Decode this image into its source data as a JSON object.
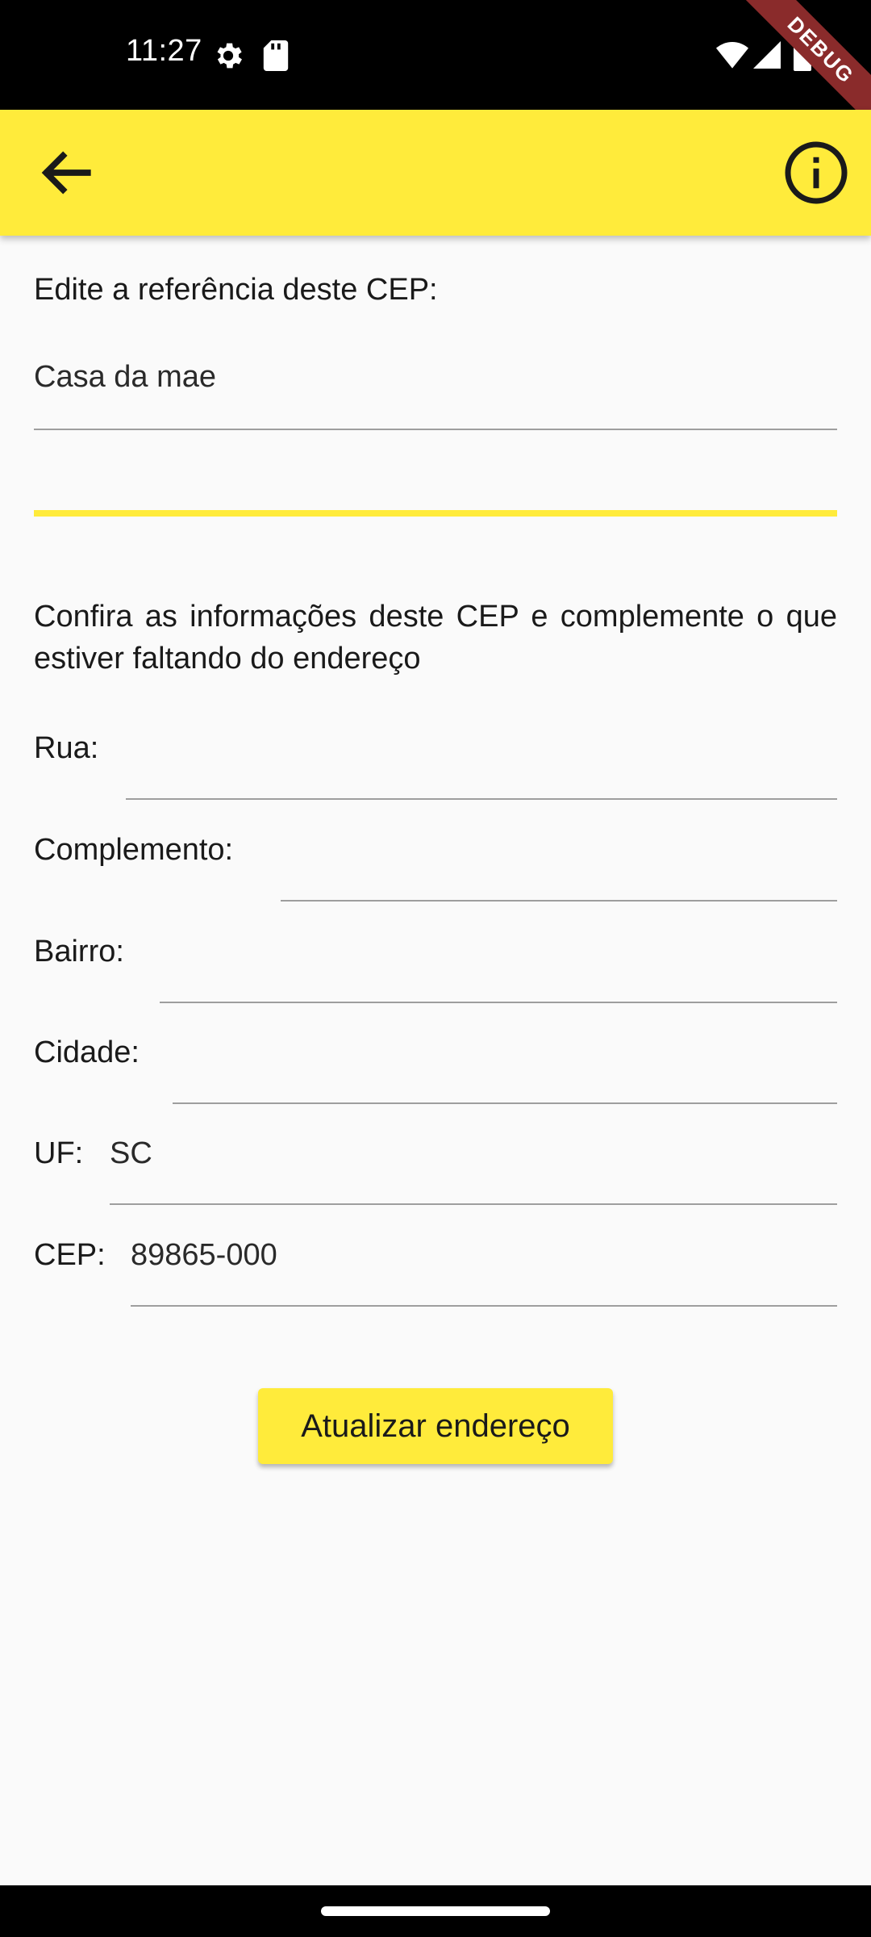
{
  "status_bar": {
    "time": "11:27",
    "icons": [
      "settings-gear-icon",
      "sd-card-icon",
      "wifi-icon",
      "signal-icon",
      "battery-icon"
    ],
    "debug_label": "DEBUG"
  },
  "app_bar": {
    "color": "#ffeb3b",
    "back_icon": "arrow-back-icon",
    "info_icon": "info-icon"
  },
  "reference": {
    "label": "Edite a referência deste CEP:",
    "value": "Casa da mae"
  },
  "instructions": "Confira as informações deste CEP e complemente o que estiver faltando do endereço",
  "address": {
    "rua_label": "Rua:",
    "rua_value": "",
    "complemento_label": "Complemento:",
    "complemento_value": "",
    "bairro_label": "Bairro:",
    "bairro_value": "",
    "cidade_label": "Cidade:",
    "cidade_value": "",
    "uf_label": "UF:",
    "uf_value": "SC",
    "cep_label": "CEP:",
    "cep_value": "89865-000"
  },
  "actions": {
    "update_label": "Atualizar endereço"
  },
  "colors": {
    "accent": "#ffeb3b",
    "background": "#fafafa",
    "debug_ribbon": "#8a2b2b"
  }
}
